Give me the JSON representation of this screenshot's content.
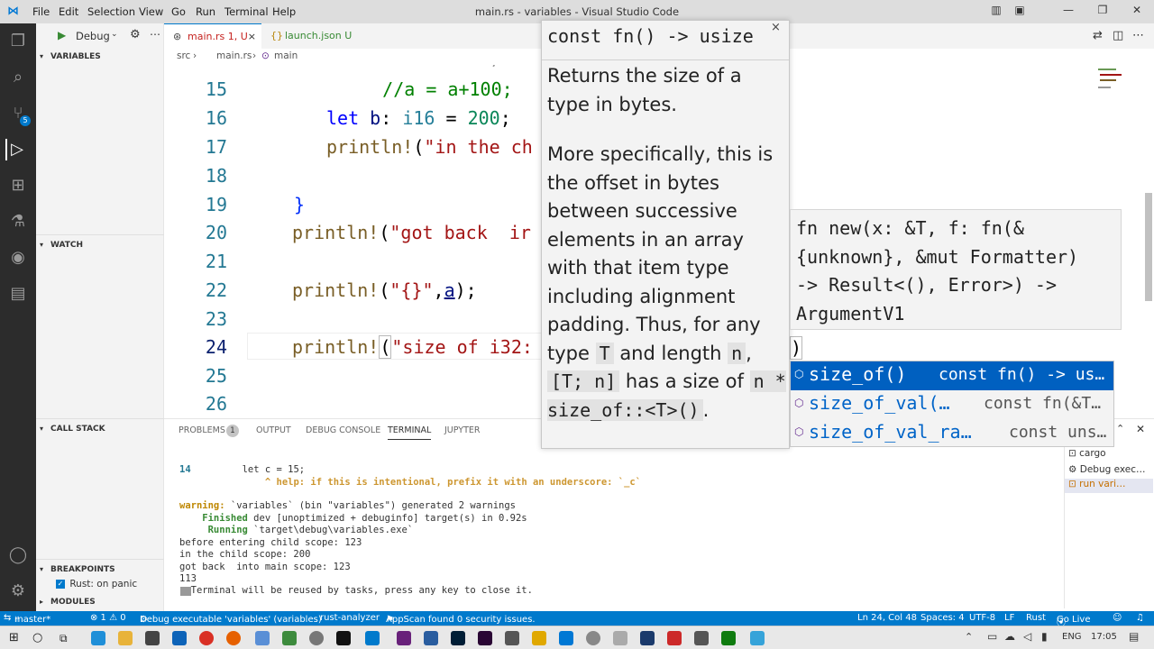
{
  "titlebar": {
    "menus": [
      "File",
      "Edit",
      "Selection",
      "View",
      "Go",
      "Run",
      "Terminal",
      "Help"
    ],
    "title": "main.rs - variables - Visual Studio Code"
  },
  "activity": {
    "scm_badge": "5"
  },
  "sidebar": {
    "debug_label": "Debug",
    "variables": "VARIABLES",
    "watch": "WATCH",
    "call_stack": "CALL STACK",
    "breakpoints": "BREAKPOINTS",
    "rust_panic": "Rust: on panic",
    "modules": "MODULES"
  },
  "tabs": [
    {
      "label": "main.rs",
      "suffix": "1, U"
    },
    {
      "label": "launch.json",
      "suffix": "U"
    }
  ],
  "breadcrumb": {
    "src": "src",
    "file": "main.rs",
    "fn": "main"
  },
  "editor": {
    "lines": [
      {
        "n": "15",
        "code": "    //a = a+100;"
      },
      {
        "n": "16",
        "code": "    let b: i16 = 200;"
      },
      {
        "n": "17",
        "code": "    println!(\"in the ch"
      },
      {
        "n": "18",
        "code": ""
      },
      {
        "n": "19",
        "code": "}"
      },
      {
        "n": "20",
        "code": "println!(\"got back  ir"
      },
      {
        "n": "21",
        "code": ""
      },
      {
        "n": "22",
        "code": "println!(\"{}\",a);"
      },
      {
        "n": "23",
        "code": ""
      },
      {
        "n": "24",
        "code": "println!(\"size of i32:"
      },
      {
        "n": "25",
        "code": ""
      },
      {
        "n": "26",
        "code": ""
      }
    ],
    "paren_close": ")"
  },
  "hover": {
    "signature": "const fn() -> usize",
    "close": "×",
    "p1": "Returns the size of a type in bytes.",
    "p2_a": "More specifically, this is the offset in bytes between successive elements in an array with that item type including alignment padding. Thus, for any type ",
    "code_T": "T",
    "p2_b": " and length ",
    "code_n": "n",
    "p2_c": ", ",
    "code_arr": "[T; n]",
    "p2_d": " has a size of ",
    "code_expr": "n * size_of::<T>()",
    "p2_e": "."
  },
  "sighelp": {
    "line1": "fn new(x: &T, f: fn(&",
    "line2": "{unknown}, &mut Formatter)",
    "line3": "-> Result<(), Error>) ->",
    "line4": "ArgumentV1"
  },
  "suggest": [
    {
      "name": "size_of()",
      "detail": "const fn() -> us…"
    },
    {
      "name": "size_of_val(…",
      "detail": "const fn(&T…"
    },
    {
      "name": "size_of_val_ra…",
      "detail": "const uns…"
    }
  ],
  "panel": {
    "tabs": [
      "PROBLEMS",
      "OUTPUT",
      "DEBUG CONSOLE",
      "TERMINAL",
      "JUPYTER"
    ],
    "problems_count": "1",
    "terminal_side": [
      "cargo",
      "Debug exec…",
      "run vari…"
    ],
    "term": {
      "ln14": "14",
      "l1": "        let c = 15;",
      "l2": "            ^ help: if this is intentional, prefix it with an underscore: `_c`",
      "l3a": "warning:",
      "l3b": " `variables` (bin \"variables\") generated 2 warnings",
      "l4a": "    Finished",
      "l4b": " dev [unoptimized + debuginfo] target(s) in 0.92s",
      "l5a": "     Running",
      "l5b": " `target\\debug\\variables.exe`",
      "l6": "before entering child scope: 123",
      "l7": "in the child scope: 200",
      "l8": "got back  into main scope: 123",
      "l9": "113",
      "l10": "  Terminal will be reused by tasks, press any key to close it."
    }
  },
  "statusbar": {
    "branch": "master*",
    "errors": "⊗ 1 ⚠ 0",
    "debug": "Debug executable 'variables' (variables)",
    "analyzer": "rust-analyzer",
    "appscan": "AppScan found 0 security issues.",
    "pos": "Ln 24, Col 48",
    "spaces": "Spaces: 4",
    "enc": "UTF-8",
    "eol": "LF",
    "lang": "Rust",
    "golive": "Go Live"
  },
  "taskbar": {
    "lang": "ENG",
    "time": "17:05"
  },
  "colors": {
    "accent": "#007acc",
    "keyword": "#0000ff",
    "macro": "#795e26",
    "string": "#a31515",
    "comment": "#008000",
    "type": "#267f99"
  }
}
